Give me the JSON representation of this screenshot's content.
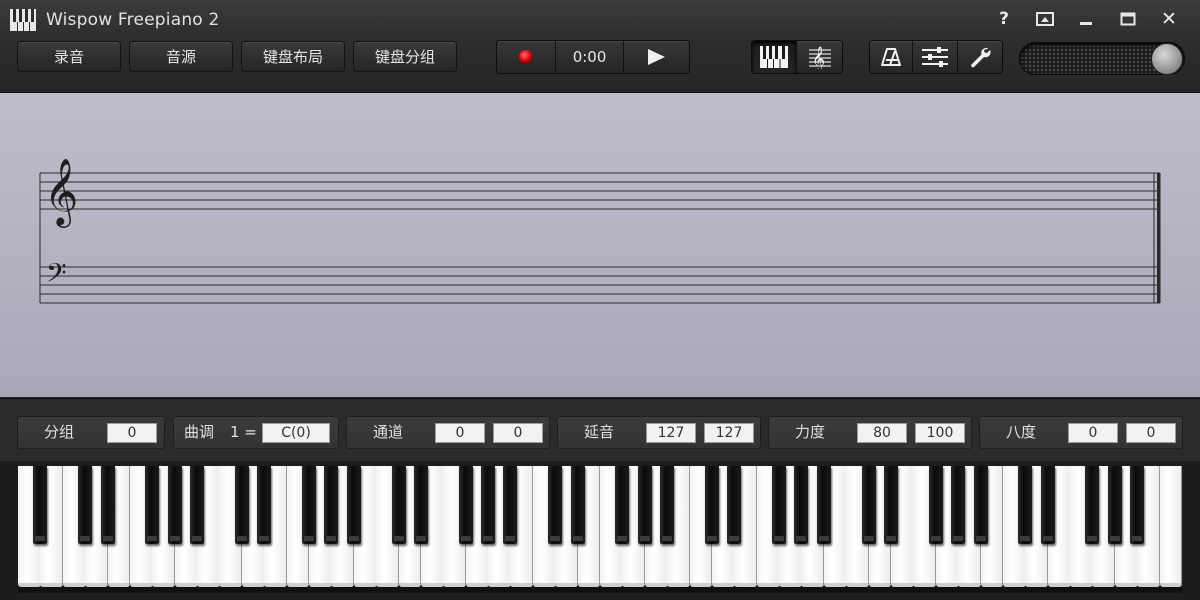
{
  "window": {
    "title": "Wispow Freepiano 2",
    "controls": {
      "help": "?",
      "minimize_icon": "minimize-icon",
      "maximize_icon": "maximize-icon",
      "close": "✕"
    }
  },
  "toolbar": {
    "record_label": "录音",
    "sound_source_label": "音源",
    "keyboard_layout_label": "键盘布局",
    "keyboard_group_label": "键盘分组",
    "transport": {
      "time": "0:00",
      "record_icon": "record-icon",
      "play_icon": "play-icon"
    },
    "view_modes": {
      "piano_icon": "piano-icon",
      "score_icon": "treble-clef-score-icon",
      "active": "piano"
    },
    "tools": {
      "metronome_icon": "metronome-icon",
      "mixer_icon": "sliders-icon",
      "settings_icon": "wrench-icon"
    },
    "volume": {
      "level": 1.0
    }
  },
  "score": {
    "staves": [
      "treble",
      "bass"
    ],
    "treble_clef": "𝄞",
    "bass_clef": "𝄢"
  },
  "status": {
    "group": {
      "label": "分组",
      "value": "0"
    },
    "key": {
      "label": "曲调",
      "prefix": "1 =",
      "value": "C(0)"
    },
    "channel": {
      "label": "通道",
      "values": [
        "0",
        "0"
      ]
    },
    "sustain": {
      "label": "延音",
      "values": [
        "127",
        "127"
      ]
    },
    "velocity": {
      "label": "力度",
      "values": [
        "80",
        "100"
      ]
    },
    "octave": {
      "label": "八度",
      "values": [
        "0",
        "0"
      ]
    }
  },
  "keyboard": {
    "white_keys": 52,
    "black_keys": 36
  },
  "colors": {
    "record_red": "#e0101a",
    "panel": "#2b2b2b",
    "score_bg": "#b4b3c2"
  }
}
